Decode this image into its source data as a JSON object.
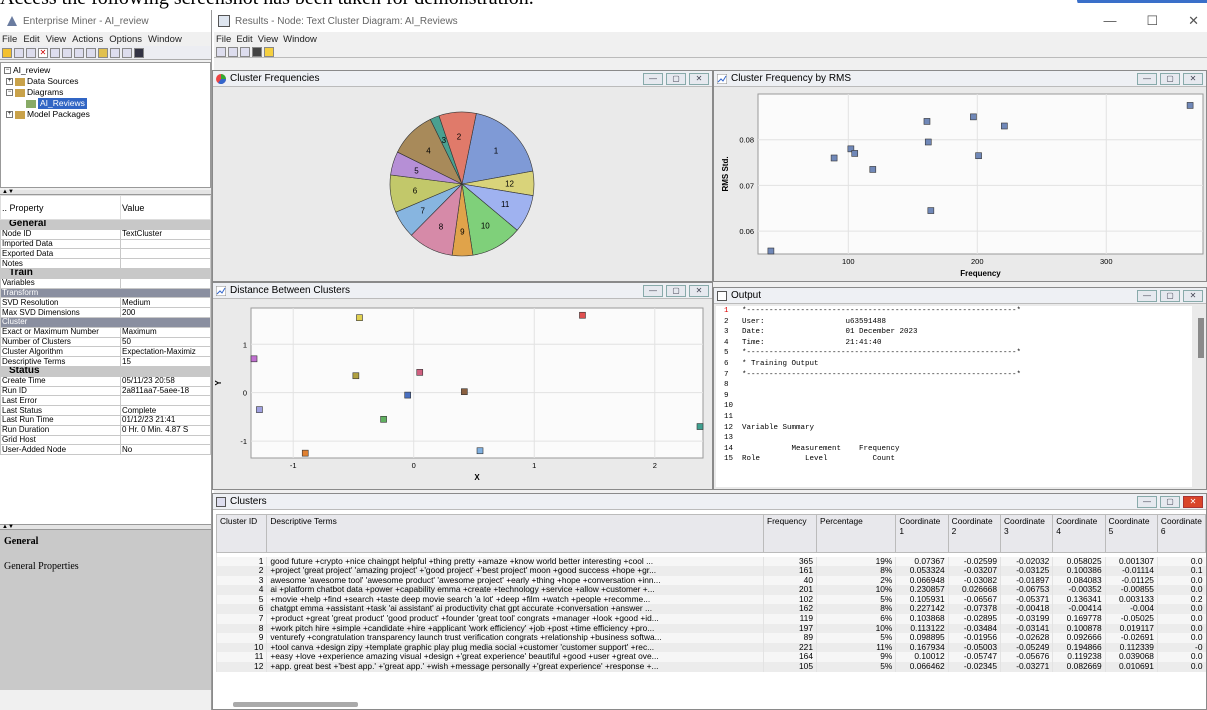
{
  "caption_text": "Access the following screenshot has been taken for demonstration.",
  "em": {
    "title": "Enterprise Miner - AI_review",
    "menu": [
      "File",
      "Edit",
      "View",
      "Actions",
      "Options",
      "Window"
    ],
    "tree": {
      "root": "AI_review",
      "items": [
        "Data Sources",
        "Diagrams",
        "AI_Reviews",
        "Model Packages"
      ]
    },
    "props_header": {
      "property": "Property",
      "value": "Value"
    },
    "props": [
      {
        "t": "grp",
        "k": "General"
      },
      {
        "k": "Node ID",
        "v": "TextCluster"
      },
      {
        "k": "Imported Data",
        "v": ""
      },
      {
        "k": "Exported Data",
        "v": ""
      },
      {
        "k": "Notes",
        "v": ""
      },
      {
        "t": "grp",
        "k": "Train"
      },
      {
        "k": "Variables",
        "v": ""
      },
      {
        "t": "grp2",
        "k": "Transform"
      },
      {
        "k": "SVD Resolution",
        "v": "Medium"
      },
      {
        "k": "Max SVD Dimensions",
        "v": "200"
      },
      {
        "t": "grp2",
        "k": "Cluster"
      },
      {
        "k": "Exact or Maximum Number",
        "v": "Maximum"
      },
      {
        "k": "Number of Clusters",
        "v": "50"
      },
      {
        "k": "Cluster Algorithm",
        "v": "Expectation-Maximiz"
      },
      {
        "k": "Descriptive Terms",
        "v": "15"
      },
      {
        "t": "grp",
        "k": "Status"
      },
      {
        "k": "Create Time",
        "v": "05/11/23 20:58"
      },
      {
        "k": "Run ID",
        "v": "2a811aa7-5aee-18"
      },
      {
        "k": "Last Error",
        "v": ""
      },
      {
        "k": "Last Status",
        "v": "Complete"
      },
      {
        "k": "Last Run Time",
        "v": "01/12/23 21:41"
      },
      {
        "k": "Run Duration",
        "v": "0 Hr. 0 Min. 4.87 S"
      },
      {
        "k": "Grid Host",
        "v": ""
      },
      {
        "k": "User-Added Node",
        "v": "No"
      }
    ],
    "general_title": "General",
    "general_props": "General Properties"
  },
  "res": {
    "title": "Results - Node: Text Cluster  Diagram: AI_Reviews",
    "menu": [
      "File",
      "Edit",
      "View",
      "Window"
    ],
    "win_min": "—",
    "win_max": "☐",
    "win_close": "✕",
    "panels": {
      "pie": "Cluster Frequencies",
      "rms": "Cluster Frequency by RMS",
      "dist": "Distance Between Clusters",
      "output": "Output",
      "clusters": "Clusters"
    },
    "btn_min": "—",
    "btn_max": "▢",
    "btn_close": "✕"
  },
  "colors": {
    "pie": [
      "#7f9ad6",
      "#d9d37a",
      "#9fb2f0",
      "#7fd07a",
      "#e0a34a",
      "#d68aa8",
      "#87b5e0",
      "#c2c86a",
      "#b68fd6",
      "#a88a5a",
      "#4aa090",
      "#e07a6a"
    ]
  },
  "chart_data": [
    {
      "type": "pie",
      "title": "Cluster Frequencies",
      "categories": [
        "1",
        "12",
        "11",
        "10",
        "9",
        "8",
        "7",
        "6",
        "5",
        "4",
        "3",
        "2"
      ],
      "values": [
        365,
        105,
        164,
        221,
        89,
        197,
        119,
        162,
        102,
        201,
        40,
        161
      ]
    },
    {
      "type": "scatter",
      "title": "Cluster Frequency by RMS",
      "xlabel": "Frequency",
      "ylabel": "RMS Std.",
      "xticks": [
        "100",
        "200",
        "300"
      ],
      "yticks": [
        "0.06",
        "0.07",
        "0.08"
      ],
      "xlim": [
        30,
        375
      ],
      "ylim": [
        0.055,
        0.09
      ],
      "points": [
        {
          "x": 365,
          "y": 0.0875
        },
        {
          "x": 161,
          "y": 0.084
        },
        {
          "x": 40,
          "y": 0.0555
        },
        {
          "x": 201,
          "y": 0.0765
        },
        {
          "x": 102,
          "y": 0.078
        },
        {
          "x": 162,
          "y": 0.0795
        },
        {
          "x": 119,
          "y": 0.0735
        },
        {
          "x": 197,
          "y": 0.085
        },
        {
          "x": 89,
          "y": 0.076
        },
        {
          "x": 221,
          "y": 0.083
        },
        {
          "x": 164,
          "y": 0.0645
        },
        {
          "x": 105,
          "y": 0.077
        }
      ]
    },
    {
      "type": "scatter",
      "title": "Distance Between Clusters",
      "xlabel": "X",
      "ylabel": "Y",
      "xticks": [
        "-1",
        "0",
        "1",
        "2"
      ],
      "yticks": [
        "1",
        "0",
        "-1"
      ],
      "xlim": [
        -1.35,
        2.4
      ],
      "ylim": [
        -1.35,
        1.75
      ],
      "points": [
        {
          "x": -0.05,
          "y": -0.05,
          "color": "#4a70c0"
        },
        {
          "x": -0.45,
          "y": 1.55,
          "color": "#e0d050"
        },
        {
          "x": 1.4,
          "y": 1.6,
          "color": "#e05050"
        },
        {
          "x": -1.35,
          "y": 0.7,
          "color": "#c070d0"
        },
        {
          "x": -1.28,
          "y": -0.35,
          "color": "#9fa0e0"
        },
        {
          "x": -0.48,
          "y": 0.35,
          "color": "#b0a040"
        },
        {
          "x": 0.05,
          "y": 0.42,
          "color": "#d06080"
        },
        {
          "x": 0.42,
          "y": 0.02,
          "color": "#8a6040"
        },
        {
          "x": -0.25,
          "y": -0.55,
          "color": "#60b060"
        },
        {
          "x": -0.9,
          "y": -1.25,
          "color": "#e08030"
        },
        {
          "x": 0.55,
          "y": -1.2,
          "color": "#80b0e0"
        },
        {
          "x": 2.4,
          "y": -0.7,
          "color": "#40a090"
        }
      ]
    }
  ],
  "output": {
    "lines": [
      {
        "n": "1",
        "t": "*------------------------------------------------------------*",
        "red": true
      },
      {
        "n": "2",
        "t": "User:                  u63591488"
      },
      {
        "n": "3",
        "t": "Date:                  01 December 2023"
      },
      {
        "n": "4",
        "t": "Time:                  21:41:40"
      },
      {
        "n": "5",
        "t": "*------------------------------------------------------------*"
      },
      {
        "n": "6",
        "t": "* Training Output"
      },
      {
        "n": "7",
        "t": "*------------------------------------------------------------*"
      },
      {
        "n": "8",
        "t": ""
      },
      {
        "n": "9",
        "t": ""
      },
      {
        "n": "10",
        "t": ""
      },
      {
        "n": "11",
        "t": ""
      },
      {
        "n": "12",
        "t": "Variable Summary"
      },
      {
        "n": "13",
        "t": ""
      },
      {
        "n": "14",
        "t": "           Measurement    Frequency"
      },
      {
        "n": "15",
        "t": "Role          Level          Count"
      }
    ]
  },
  "clusters": {
    "headers": [
      "Cluster ID",
      "Descriptive Terms",
      "Frequency",
      "Percentage",
      "Coordinate 1",
      "Coordinate 2",
      "Coordinate 3",
      "Coordinate 4",
      "Coordinate 5",
      "Coordinate 6"
    ],
    "rows": [
      [
        "1",
        "good future +crypto +nice chaingpt helpful +thing pretty +amaze +know world better interesting +cool ...",
        "365",
        "19%",
        "0.07367",
        "-0.02599",
        "-0.02032",
        "0.058025",
        "0.001307",
        "0.0"
      ],
      [
        "2",
        "+project 'great project' 'amazing project' +'good project' +'best project' moon +good success +hope +gr...",
        "161",
        "8%",
        "0.053324",
        "-0.03207",
        "-0.03125",
        "0.100386",
        "-0.01114",
        "0.1"
      ],
      [
        "3",
        "awesome 'awesome tool' 'awesome product' 'awesome project' +early +thing +hope +conversation +inn...",
        "40",
        "2%",
        "0.066948",
        "-0.03082",
        "-0.01897",
        "0.084083",
        "-0.01125",
        "0.0"
      ],
      [
        "4",
        "ai +platform chatbot data +power +capability emma +create +technology +service +allow +customer +...",
        "201",
        "10%",
        "0.230857",
        "0.026668",
        "-0.06753",
        "-0.00352",
        "-0.00855",
        "0.0"
      ],
      [
        "5",
        "+movie +help +find +search +taste deep movie search 'a lot' +deep +film +watch +people +recomme...",
        "102",
        "5%",
        "0.105931",
        "-0.06567",
        "-0.05371",
        "0.136341",
        "0.003133",
        "0.2"
      ],
      [
        "6",
        "chatgpt emma +assistant +task 'ai assistant' ai productivity chat gpt accurate +conversation +answer ...",
        "162",
        "8%",
        "0.227142",
        "-0.07378",
        "-0.00418",
        "-0.00414",
        "-0.004",
        "0.0"
      ],
      [
        "7",
        "+product +great 'great product' 'good product' +founder 'great tool' congrats +manager +look +good +id...",
        "119",
        "6%",
        "0.103868",
        "-0.02895",
        "-0.03199",
        "0.169778",
        "-0.05025",
        "0.0"
      ],
      [
        "8",
        "+work pitch hire +simple +candidate +hire +applicant 'work efficiency' +job +post +time efficiency +pro...",
        "197",
        "10%",
        "0.113122",
        "-0.03484",
        "-0.03141",
        "0.100878",
        "0.019117",
        "0.0"
      ],
      [
        "9",
        "venturefy +congratulation transparency launch trust verification congrats +relationship +business softwa...",
        "89",
        "5%",
        "0.098895",
        "-0.01956",
        "-0.02628",
        "0.092666",
        "-0.02691",
        "0.0"
      ],
      [
        "10",
        "+tool canva +design zipy +template graphic play plug media social +customer 'customer support' +rec...",
        "221",
        "11%",
        "0.167934",
        "-0.05003",
        "-0.05249",
        "0.194866",
        "0.112339",
        "-0"
      ],
      [
        "11",
        "+easy +love +experience amazing visual +design +'great experience' beautiful +good +user +great ove...",
        "164",
        "9%",
        "0.10012",
        "-0.05747",
        "-0.05676",
        "0.119238",
        "0.039068",
        "0.0"
      ],
      [
        "12",
        "+app. great best +'best app.' +'great app.' +wish +message personally +'great experience' +response +...",
        "105",
        "5%",
        "0.066462",
        "-0.02345",
        "-0.03271",
        "0.082669",
        "0.010691",
        "0.0"
      ]
    ]
  }
}
